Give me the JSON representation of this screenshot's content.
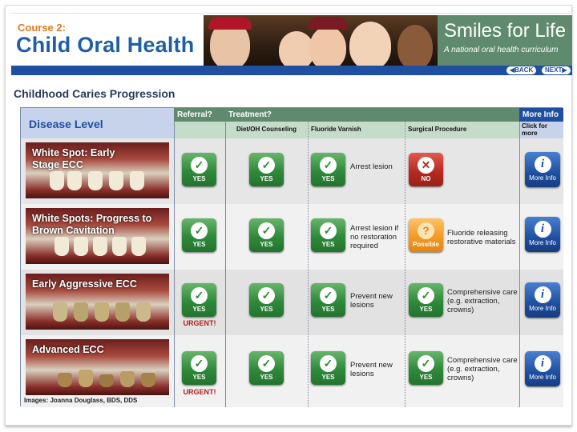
{
  "header": {
    "course_label": "Course 2:",
    "course_title": "Child Oral Health",
    "brand_name": "Smiles for Life",
    "brand_tagline": "A national oral health curriculum"
  },
  "nav": {
    "back": "BACK",
    "next": "NEXT"
  },
  "page_title": "Childhood Caries Progression",
  "table": {
    "disease_header": "Disease Level",
    "referral_header": "Referral?",
    "treatment_header": "Treatment?",
    "more_info_header": "More Info",
    "sub_headers": {
      "counseling": "Diet/OH Counseling",
      "varnish": "Fluoride Varnish",
      "surgical": "Surgical Procedure",
      "click_for_more": "Click for more"
    },
    "rows": [
      {
        "disease": "White Spot: Early Stage ECC",
        "referral": "YES",
        "referral_note": "",
        "counseling": "YES",
        "varnish": "YES",
        "varnish_text": "Arrest lesion",
        "surgical": "NO",
        "surgical_text": "",
        "more_info": "More Info"
      },
      {
        "disease": "White Spots: Progress to Brown Cavitation",
        "referral": "YES",
        "referral_note": "",
        "counseling": "YES",
        "varnish": "YES",
        "varnish_text": "Arrest lesion if no restoration required",
        "surgical": "Possible",
        "surgical_text": "Fluoride releasing restorative materials",
        "more_info": "More Info"
      },
      {
        "disease": "Early Aggressive ECC",
        "referral": "YES",
        "referral_note": "URGENT!",
        "counseling": "YES",
        "varnish": "YES",
        "varnish_text": "Prevent new lesions",
        "surgical": "YES",
        "surgical_text": "Comprehensive care (e.g. extraction, crowns)",
        "more_info": "More Info"
      },
      {
        "disease": "Advanced ECC",
        "referral": "YES",
        "referral_note": "URGENT!",
        "counseling": "YES",
        "varnish": "YES",
        "varnish_text": "Prevent new lesions",
        "surgical": "YES",
        "surgical_text": "Comprehensive care (e.g. extraction, crowns)",
        "more_info": "More Info"
      }
    ],
    "image_credit": "Images: Joanna Douglass, BDS, DDS"
  },
  "icons": {
    "yes": "checkmark-icon",
    "no": "x-icon",
    "possible": "question-icon",
    "info": "info-icon"
  },
  "colors": {
    "brand_green": "#5f8a6d",
    "brand_blue": "#1f4fa0",
    "orange": "#e07a1f",
    "yes_green": "#2f8a3a",
    "no_red": "#b72a22",
    "possible_orange": "#f39b25",
    "urgent_red": "#b01e1e"
  }
}
